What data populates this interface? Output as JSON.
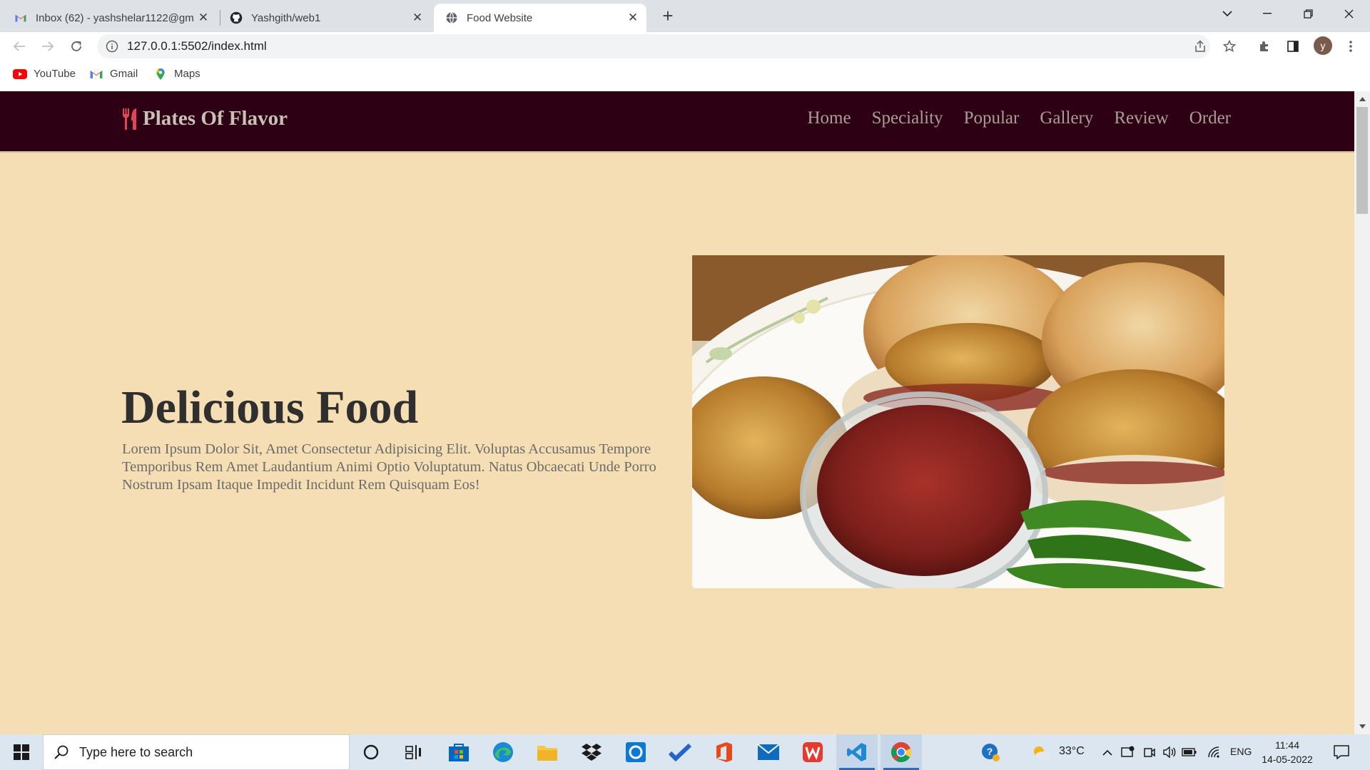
{
  "browser": {
    "tabs": [
      {
        "title": "Inbox (62) - yashshelar1122@gm",
        "icon": "gmail-icon"
      },
      {
        "title": "Yashgith/web1",
        "icon": "github-icon"
      },
      {
        "title": "Food Website",
        "icon": "globe-icon"
      }
    ],
    "close_glyph": "✕",
    "new_tab_glyph": "+",
    "url": "127.0.0.1:5502/index.html",
    "profile_initial": "y",
    "bookmarks": [
      {
        "label": "YouTube",
        "icon": "youtube-icon"
      },
      {
        "label": "Gmail",
        "icon": "gmail-icon"
      },
      {
        "label": "Maps",
        "icon": "maps-icon"
      }
    ]
  },
  "site": {
    "logo_text": "Plates Of Flavor",
    "nav": [
      "Home",
      "Speciality",
      "Popular",
      "Gallery",
      "Review",
      "Order"
    ],
    "hero": {
      "title": "Delicious Food",
      "text": "Lorem Ipsum Dolor Sit, Amet Consectetur Adipisicing Elit. Voluptas Accusamus Tempore Temporibus Rem Amet Laudantium Animi Optio Voluptatum. Natus Obcaecati Unde Porro Nostrum Ipsam Itaque Impedit Incidunt Rem Quisquam Eos!",
      "image": "vada-pav-with-chutney-and-green-chillies"
    },
    "colors": {
      "header_bg": "#2e0014",
      "page_bg": "#f5deb3",
      "logo_icon": "#e0455a"
    }
  },
  "taskbar": {
    "search_placeholder": "Type here to search",
    "weather": "33°C",
    "language": "ENG",
    "time": "11:44",
    "date": "14-05-2022"
  }
}
